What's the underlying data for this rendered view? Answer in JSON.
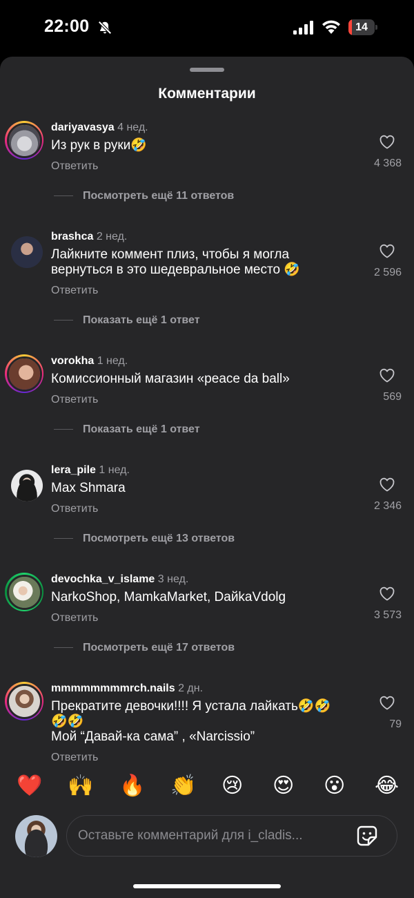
{
  "status_bar": {
    "time": "22:00",
    "battery": "14",
    "battery_level": 0.14,
    "icons": [
      "bell-slash-icon",
      "cellular-signal-icon",
      "wifi-icon",
      "battery-icon"
    ]
  },
  "sheet": {
    "title": "Комментарии"
  },
  "comments": [
    {
      "user": "dariyavasya",
      "time": "4 нед.",
      "lines": [
        "Из рук в руки🤣"
      ],
      "reply": "Ответить",
      "likes": "4 368",
      "more": "Посмотреть ещё 11 ответов",
      "story_ring": true
    },
    {
      "user": "brashca",
      "time": "2 нед.",
      "lines": [
        "Лайкните коммент плиз, чтобы я могла",
        "вернуться в это шедевральное место 🤣"
      ],
      "reply": "Ответить",
      "likes": "2 596",
      "more": "Показать ещё 1 ответ",
      "story_ring": false
    },
    {
      "user": "vorokha",
      "time": "1 нед.",
      "lines": [
        "Комиссионный магазин «peace da ball»"
      ],
      "reply": "Ответить",
      "likes": "569",
      "more": "Показать ещё 1 ответ",
      "story_ring": true
    },
    {
      "user": "lera_pile",
      "time": "1 нед.",
      "lines": [
        "Max Shmara"
      ],
      "reply": "Ответить",
      "likes": "2 346",
      "more": "Посмотреть ещё 13 ответов",
      "story_ring": false
    },
    {
      "user": "devochka_v_islame",
      "time": "3 нед.",
      "lines": [
        "NarkoShop, MamkaMarket, DaйkaVdolg"
      ],
      "reply": "Ответить",
      "likes": "3 573",
      "more": "Посмотреть ещё 17 ответов",
      "story_ring": true
    },
    {
      "user": "mmmmmmmmrch.nails",
      "time": "2 дн.",
      "lines": [
        "Прекратите девочки!!!! Я устала лайкать🤣🤣",
        "🤣🤣",
        "Мой “Давай-ка сама” , «Narcissio”"
      ],
      "reply": "Ответить",
      "likes": "79",
      "more": "",
      "story_ring": true
    }
  ],
  "emoji_bar": [
    "❤️",
    "🙌",
    "🔥",
    "👏",
    "😢",
    "😍",
    "😮",
    "😂"
  ],
  "composer": {
    "placeholder": "Оставьте комментарий для i_cladis..."
  },
  "colors": {
    "sheet_bg": "#262628",
    "muted_text": "#a0a0a5",
    "battery_low": "#ff453a"
  }
}
